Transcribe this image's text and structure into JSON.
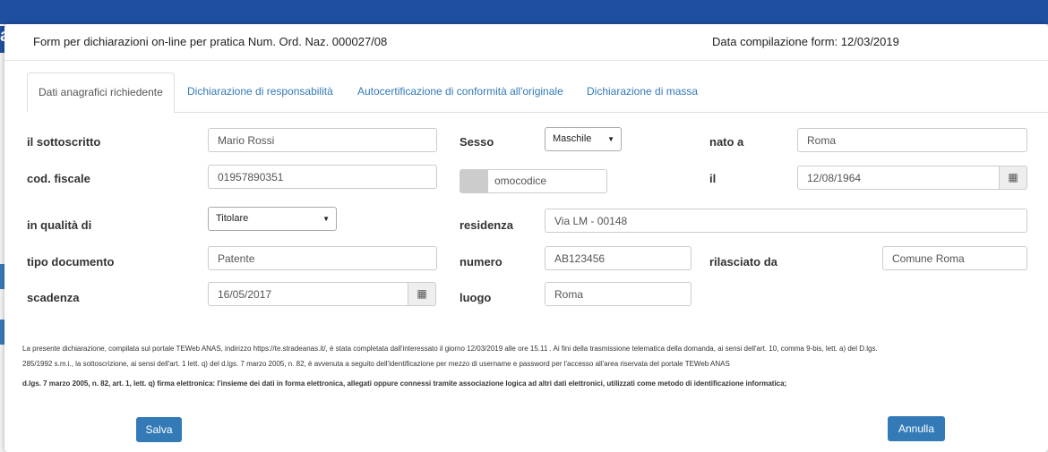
{
  "header": {
    "title": "Form per dichiarazioni on-line per pratica Num. Ord. Naz. 000027/08",
    "date": "Data compilazione form: 12/03/2019"
  },
  "tabs": [
    {
      "label": "Dati anagrafici richiedente"
    },
    {
      "label": "Dichiarazione di responsabilità"
    },
    {
      "label": "Autocertificazione di conformità all'originale"
    },
    {
      "label": "Dichiarazione di massa"
    }
  ],
  "form": {
    "sottoscritto": {
      "label": "il sottoscritto",
      "value": "Mario Rossi"
    },
    "sesso": {
      "label": "Sesso",
      "value": "Maschile"
    },
    "nato_a": {
      "label": "nato a",
      "value": "Roma"
    },
    "cod_fiscale": {
      "label": "cod. fiscale",
      "value": "01957890351"
    },
    "omocodice": {
      "label": "omocodice"
    },
    "il": {
      "label": "il",
      "value": "12/08/1964"
    },
    "qualita": {
      "label": "in qualità di",
      "value": "Titolare"
    },
    "residenza": {
      "label": "residenza",
      "value": "Via LM - 00148"
    },
    "tipo_documento": {
      "label": "tipo documento",
      "value": "Patente"
    },
    "numero": {
      "label": "numero",
      "value": "AB123456"
    },
    "rilasciato_da": {
      "label": "rilasciato da",
      "value": "Comune Roma"
    },
    "scadenza": {
      "label": "scadenza",
      "value": "16/05/2017"
    },
    "luogo": {
      "label": "luogo",
      "value": "Roma"
    }
  },
  "notes": {
    "line1": "La presente dichiarazione, compilata sul portale TEWeb ANAS, indirizzo https://te.stradeanas.it/, è stata completata dall'interessato il giorno  12/03/2019    alle ore  15.11   . Ai fini della trasmissione telematica della domanda, ai sensi dell'art. 10, comma 9-bis, lett. a) del D.lgs.",
    "line2": "285/1992 s.m.i., la sottoscrizione, ai sensi dell'art. 1 lett. q) del d.lgs. 7 marzo 2005, n. 82, è avvenuta a seguito dell'identificazione per mezzo di username e password per l'accesso all'area riservata del portale TEWeb ANAS",
    "line3": "d.lgs. 7 marzo 2005, n. 82, art. 1, lett. q) firma elettronica: l'insieme dei dati in forma elettronica, allegati oppure connessi tramite associazione logica ad altri dati elettronici, utilizzati come metodo di identificazione informatica;"
  },
  "buttons": {
    "save": "Salva",
    "cancel": "Annulla"
  },
  "colors": {
    "primary": "#337ab7",
    "brand": "#1f4fa1"
  },
  "icons": {
    "calendar": "calendar-icon",
    "dropdown": "chevron-down-icon"
  }
}
